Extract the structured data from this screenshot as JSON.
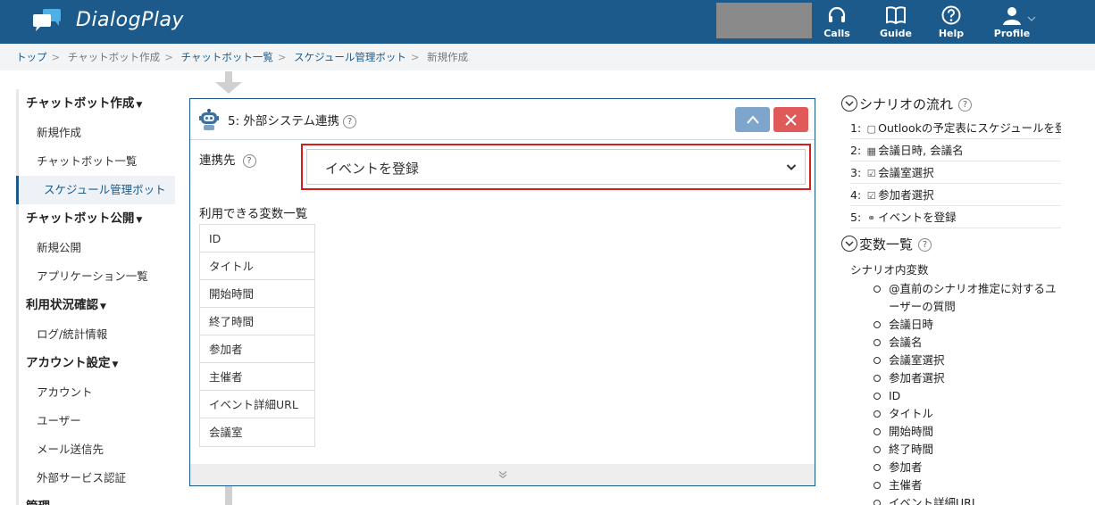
{
  "header": {
    "brand": "DialogPlay",
    "nav": [
      {
        "label": "Calls",
        "icon": "headset-icon"
      },
      {
        "label": "Guide",
        "icon": "book-icon"
      },
      {
        "label": "Help",
        "icon": "help-circle-icon"
      },
      {
        "label": "Profile",
        "icon": "user-icon"
      }
    ]
  },
  "breadcrumb": [
    {
      "label": "トップ",
      "link": true
    },
    {
      "label": "チャットボット作成",
      "link": false
    },
    {
      "label": "チャットボット一覧",
      "link": true
    },
    {
      "label": "スケジュール管理ボット",
      "link": true
    },
    {
      "label": "新規作成",
      "link": false
    }
  ],
  "sidebar": {
    "sections": [
      {
        "title": "チャットボット作成",
        "items": [
          "新規作成",
          "チャットボット一覧",
          "スケジュール管理ボット"
        ]
      },
      {
        "title": "チャットボット公開",
        "items": [
          "新規公開",
          "アプリケーション一覧"
        ]
      },
      {
        "title": "利用状況確認",
        "items": [
          "ログ/統計情報"
        ]
      },
      {
        "title": "アカウント設定",
        "items": [
          "アカウント",
          "ユーザー",
          "メール送信先",
          "外部サービス認証"
        ]
      },
      {
        "title": "管理",
        "items": []
      }
    ]
  },
  "panel": {
    "title": "5: 外部システム連携",
    "field_label": "連携先",
    "select_value": "イベントを登録",
    "vars_title": "利用できる変数一覧",
    "vars": [
      "ID",
      "タイトル",
      "開始時間",
      "終了時間",
      "参加者",
      "主催者",
      "イベント詳細URL",
      "会議室"
    ]
  },
  "right": {
    "flow_title": "シナリオの流れ",
    "flow_items": [
      {
        "num": "1:",
        "icon": "chat-icon",
        "glyph": "▢",
        "text": "Outlookの予定表にスケジュールを登録"
      },
      {
        "num": "2:",
        "icon": "calendar-icon",
        "glyph": "▦",
        "text": "会議日時, 会議名"
      },
      {
        "num": "3:",
        "icon": "select-icon",
        "glyph": "☑",
        "text": "会議室選択"
      },
      {
        "num": "4:",
        "icon": "select-icon",
        "glyph": "☑",
        "text": "参加者選択"
      },
      {
        "num": "5:",
        "icon": "link-icon",
        "glyph": "⚭",
        "text": "イベントを登録"
      }
    ],
    "vars_title": "変数一覧",
    "vars_sub": "シナリオ内変数",
    "vars": [
      "@直前のシナリオ推定に対するユーザーの質問",
      "会議日時",
      "会議名",
      "会議室選択",
      "参加者選択",
      "ID",
      "タイトル",
      "開始時間",
      "終了時間",
      "参加者",
      "主催者",
      "イベント詳細URL"
    ]
  }
}
